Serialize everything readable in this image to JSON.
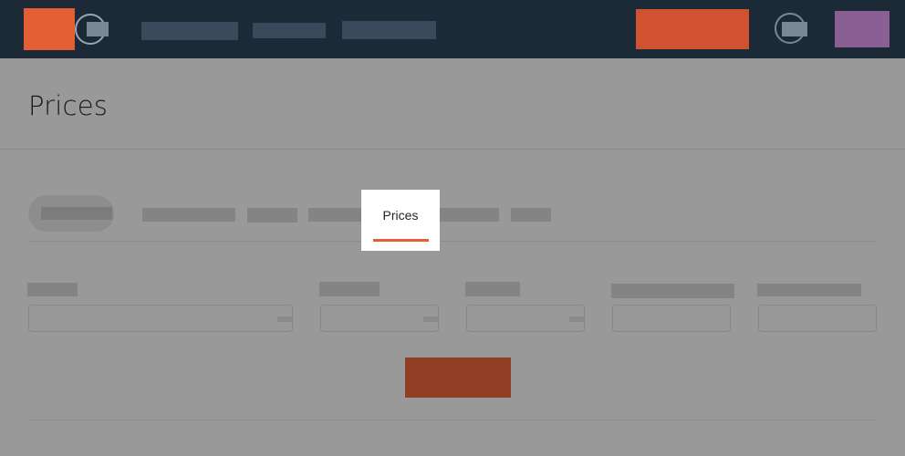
{
  "page": {
    "title": "Prices"
  },
  "tabs": {
    "active_label": "Prices"
  },
  "colors": {
    "topbar": "#1c2a38",
    "brand": "#e35e35",
    "cta": "#d0522e",
    "avatar": "#8a5f94",
    "active_tab_underline": "#e35e35",
    "search_button": "#f0693c",
    "overlay": "rgba(0,0,0,0.40)"
  },
  "icons": {
    "logo": "logo-icon",
    "nav_toggle": "hamburger-icon",
    "help": "help-icon",
    "user": "avatar"
  }
}
